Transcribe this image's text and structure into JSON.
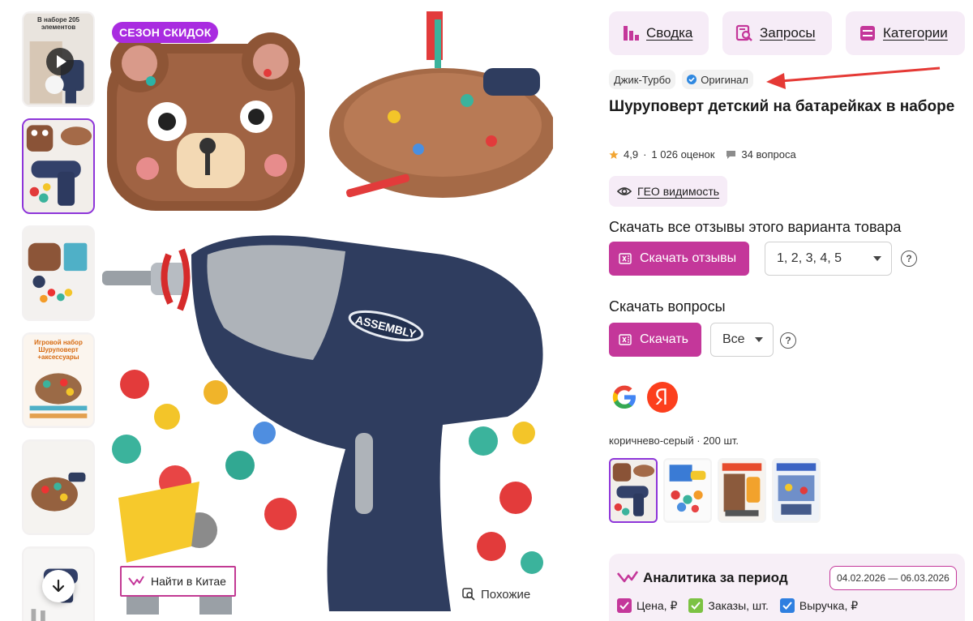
{
  "gallery": {
    "sale_badge": "СЕЗОН СКИДОК",
    "thumbs": [
      {
        "caption": "В наборе 205 элементов",
        "kind": "video"
      },
      {
        "caption": "",
        "kind": "image"
      },
      {
        "caption": "",
        "kind": "image"
      },
      {
        "caption": "Игровой набор Шуруповерт +аксессуары",
        "kind": "image"
      },
      {
        "caption": "",
        "kind": "image"
      },
      {
        "caption": "",
        "kind": "image"
      }
    ],
    "find_in_china": "Найти в Китае",
    "similar": "Похожие",
    "drill_label": "ASSEMBLY"
  },
  "nav": {
    "summary": "Сводка",
    "queries": "Запросы",
    "categories": "Категории"
  },
  "product": {
    "brand": "Джик-Турбо",
    "original": "Оригинал",
    "title": "Шуруповерт детский на батарейках в наборе",
    "rating": "4,9",
    "reviews": "1 026 оценок",
    "questions": "34 вопроса",
    "geo_button": "ГЕО видимость"
  },
  "reviews_download": {
    "title": "Скачать все отзывы этого варианта товара",
    "button": "Скачать отзывы",
    "select_value": "1, 2, 3, 4, 5"
  },
  "questions_download": {
    "title": "Скачать вопросы",
    "button": "Скачать",
    "select_value": "Все"
  },
  "variant_label": "коричнево-серый · 200 шт.",
  "analytics": {
    "title": "Аналитика за период",
    "date_range": "04.02.2026 — 06.03.2026",
    "checks": [
      "Цена, ₽",
      "Заказы, шт.",
      "Выручка, ₽"
    ]
  },
  "colors": {
    "accent": "#c4379a",
    "purple": "#8e35d9",
    "nav_bg": "#f6ecf7",
    "arrow_red": "#e53935"
  }
}
